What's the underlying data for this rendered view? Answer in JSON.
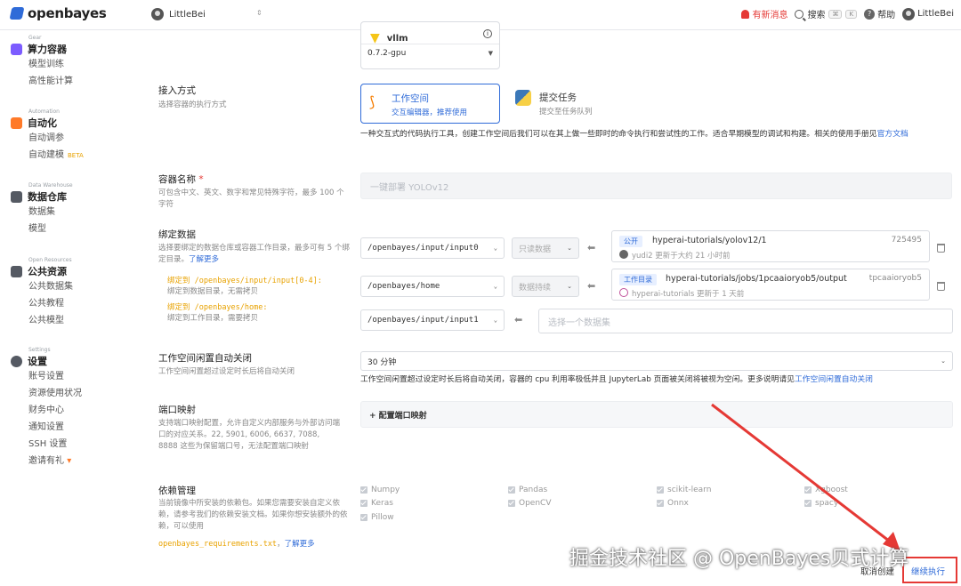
{
  "topbar": {
    "brand": "openbayes",
    "workspace": "LittleBei",
    "notification": "有新消息",
    "search": "搜索",
    "search_kbd1": "⌘",
    "search_kbd2": "K",
    "help": "帮助",
    "user": "LittleBei"
  },
  "sidebar": {
    "groups": [
      {
        "category": "Gear",
        "title": "算力容器",
        "icon_color": "#7c5cff",
        "items": [
          "模型训练",
          "高性能计算"
        ]
      },
      {
        "category": "Automation",
        "title": "自动化",
        "icon_color": "#ff7a29",
        "items": [
          "自动调参",
          "自动建模"
        ],
        "beta": "BETA"
      },
      {
        "category": "Data Warehouse",
        "title": "数据仓库",
        "icon_color": "#555a63",
        "items": [
          "数据集",
          "模型"
        ]
      },
      {
        "category": "Open Resources",
        "title": "公共资源",
        "icon_color": "#555a63",
        "items": [
          "公共数据集",
          "公共教程",
          "公共模型"
        ]
      },
      {
        "category": "Settings",
        "title": "设置",
        "icon_color": "#555a63",
        "items": [
          "账号设置",
          "资源使用状况",
          "财务中心",
          "通知设置",
          "SSH 设置",
          "邀请有礼"
        ]
      }
    ]
  },
  "image": {
    "name": "vllm",
    "version": "0.7.2-gpu"
  },
  "access": {
    "label": "接入方式",
    "sub": "选择容器的执行方式",
    "opt1_title": "工作空间",
    "opt1_sub": "交互编辑器，推荐使用",
    "opt2_title": "提交任务",
    "opt2_sub": "提交至任务队列",
    "desc": "一种交互式的代码执行工具，创建工作空间后我们可以在其上做一些即时的命令执行和尝试性的工作。适合早期模型的调试和构建。相关的使用手册见",
    "desc_link": "官方文档"
  },
  "container_name": {
    "label": "容器名称",
    "req": "*",
    "sub": "可包含中文、英文、数字和常见特殊字符，最多 100 个字符",
    "placeholder": "一键部署 YOLOv12"
  },
  "bind": {
    "label": "绑定数据",
    "sub": "选择要绑定的数据仓库或容器工作目录，最多可有 5 个绑定目录。",
    "sub_link": "了解更多",
    "note1_a": "绑定到 /openbayes/input/input[0-4]:",
    "note1_b": "绑定到数据目录，无需拷贝",
    "note2_a": "绑定到 /openbayes/home:",
    "note2_b": "绑定到工作目录，需要拷贝",
    "rows": [
      {
        "path": "/openbayes/input/input0",
        "mode": "只读数据",
        "tag": "公开",
        "name": "hyperai-tutorials/yolov12/1",
        "id": "725495",
        "meta_user": "yudi2",
        "meta": "更新于大约 21 小时前"
      },
      {
        "path": "/openbayes/home",
        "mode": "数据持续",
        "tag": "工作目录",
        "name": "hyperai-tutorials/jobs/1pcaaioryob5/output",
        "id": "tpcaaioryob5",
        "meta_user": "hyperai-tutorials",
        "meta": "更新于 1 天前"
      }
    ],
    "row3_path": "/openbayes/input/input1",
    "row3_placeholder": "选择一个数据集"
  },
  "idle": {
    "label": "工作空间闲置自动关闭",
    "sub": "工作空间闲置超过设定时长后将自动关闭",
    "value": "30 分钟",
    "desc": "工作空间闲置超过设定时长后将自动关闭，容器的 cpu 利用率极低并且 JupyterLab 页面被关闭将被视为空闲。更多说明请见",
    "desc_link": "工作空间闲置自动关闭"
  },
  "ports": {
    "label": "端口映射",
    "sub": "支持端口映射配置，允许自定义内部服务与外部访问端口的对应关系。22, 5901, 6006, 6637, 7088, 8888 这些为保留端口号，无法配置端口映射",
    "button": "+ 配置端口映射"
  },
  "deps": {
    "label": "依赖管理",
    "sub": "当前镜像中所安装的依赖包。如果您需要安装自定义依赖，请参考我们的依赖安装文档。如果你想安装额外的依赖，可以使用",
    "file": "openbayes_requirements.txt",
    "link": "了解更多",
    "pkgs": [
      "Numpy",
      "Pandas",
      "scikit-learn",
      "Xgboost",
      "Keras",
      "OpenCV",
      "Onnx",
      "spacy",
      "Pillow"
    ]
  },
  "footer": {
    "cancel": "取消创建",
    "continue": "继续执行"
  },
  "watermark": "掘金技术社区 @ OpenBayes贝式计算",
  "colors": {
    "brand": "#2f6bd8",
    "danger": "#e53935",
    "warn": "#e8a200"
  }
}
